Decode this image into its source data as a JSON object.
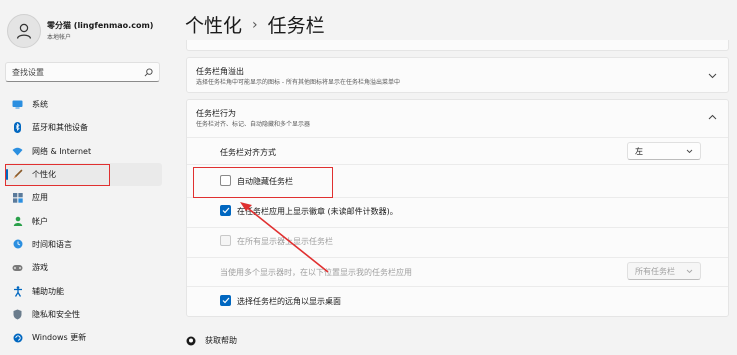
{
  "user": {
    "name": "零分猫 (lingfenmao.com)",
    "account_type": "本地帐户"
  },
  "search": {
    "placeholder": "查找设置"
  },
  "sidebar": {
    "items": [
      {
        "label": "系统",
        "icon": "monitor-icon",
        "color": "#0078d4"
      },
      {
        "label": "蓝牙和其他设备",
        "icon": "bluetooth-icon",
        "color": "#0067c0"
      },
      {
        "label": "网络 & Internet",
        "icon": "wifi-icon",
        "color": "#0067c0"
      },
      {
        "label": "个性化",
        "icon": "brush-icon",
        "color": "#c56c2e",
        "active": true
      },
      {
        "label": "应用",
        "icon": "apps-icon",
        "color": "#4a6c8c"
      },
      {
        "label": "帐户",
        "icon": "account-icon",
        "color": "#2aa04a"
      },
      {
        "label": "时间和语言",
        "icon": "globe-clock-icon",
        "color": "#0067c0"
      },
      {
        "label": "游戏",
        "icon": "gamepad-icon",
        "color": "#6a6a6a"
      },
      {
        "label": "辅助功能",
        "icon": "accessibility-icon",
        "color": "#0067c0"
      },
      {
        "label": "隐私和安全性",
        "icon": "shield-icon",
        "color": "#6a7c8c"
      },
      {
        "label": "Windows 更新",
        "icon": "update-icon",
        "color": "#0067c0"
      }
    ]
  },
  "breadcrumb": {
    "parent": "个性化",
    "separator": "›",
    "current": "任务栏"
  },
  "overflow": {
    "title": "任务栏角溢出",
    "subtitle": "选择任务栏角中可能显示的图标 - 所有其他图标将显示在任务栏角溢出菜单中"
  },
  "behaviors": {
    "title": "任务栏行为",
    "subtitle": "任务栏对齐、标记、自动隐藏和多个显示器",
    "alignment": {
      "label": "任务栏对齐方式",
      "value": "左"
    },
    "auto_hide": {
      "label": "自动隐藏任务栏",
      "checked": false
    },
    "badges": {
      "label": "在任务栏应用上显示徽章 (未读邮件计数器)。",
      "checked": true
    },
    "all_displays": {
      "label": "在所有显示器上显示任务栏",
      "checked": false,
      "disabled": true
    },
    "multi_display": {
      "label": "当使用多个显示器时，在以下位置显示我的任务栏应用",
      "value": "所有任务栏",
      "disabled": true
    },
    "far_corner": {
      "label": "选择任务栏的远角以显示桌面",
      "checked": true
    }
  },
  "help": {
    "label": "获取帮助"
  },
  "colors": {
    "accent": "#0067c0",
    "annotation": "#e03030"
  }
}
